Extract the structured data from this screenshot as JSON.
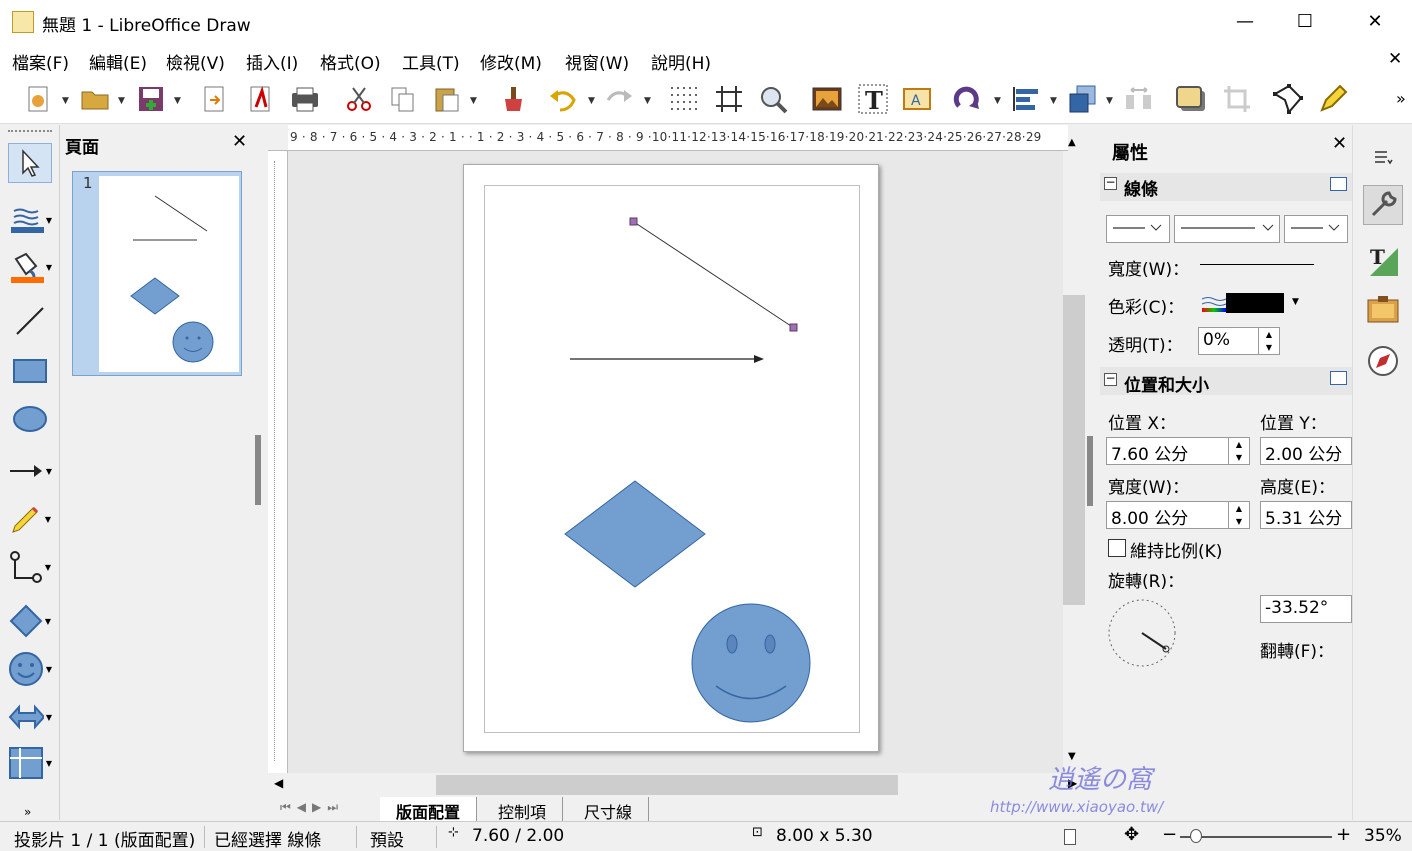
{
  "window": {
    "title": "無題 1 - LibreOffice Draw",
    "minimize": "—",
    "maximize": "☐",
    "close": "✕"
  },
  "menubar": {
    "items": [
      "檔案(F)",
      "編輯(E)",
      "檢視(V)",
      "插入(I)",
      "格式(O)",
      "工具(T)",
      "修改(M)",
      "視窗(W)",
      "說明(H)"
    ],
    "close_doc": "✕"
  },
  "pages_panel": {
    "title": "頁面",
    "close": "✕",
    "thumb_number": "1"
  },
  "ruler": {
    "h_ticks": "9 · 8 · 7 · 6 · 5 · 4 · 3 · 2 · 1 ·   · 1 · 2 · 3 · 4 · 5 · 6 · 7 · 8 · 9 ·10·11·12·13·14·15·16·17·18·19·20·21·22·23·24·25·26·27·28·29"
  },
  "tabs": [
    "版面配置",
    "控制項",
    "尺寸線"
  ],
  "properties": {
    "title": "屬性",
    "close": "✕",
    "line_section": {
      "title": "線條",
      "width_label": "寬度(W)：",
      "color_label": "色彩(C)：",
      "transparency_label": "透明(T)：",
      "transparency_value": "0%",
      "color_value": "#000000"
    },
    "pos_section": {
      "title": "位置和大小",
      "pos_x_label": "位置 X：",
      "pos_y_label": "位置 Y：",
      "pos_x_value": "7.60 公分",
      "pos_y_value": "2.00 公分",
      "width_label": "寬度(W)：",
      "height_label": "高度(E)：",
      "width_value": "8.00 公分",
      "height_value": "5.31 公分",
      "keep_ratio_label": "維持比例(K)",
      "rotation_label": "旋轉(R)：",
      "rotation_value": "-33.52°",
      "flip_label": "翻轉(F)："
    }
  },
  "statusbar": {
    "slide": "投影片 1 / 1 (版面配置)",
    "selection": "已經選擇 線條",
    "style": "預設",
    "position": "7.60 / 2.00",
    "size": "8.00 x 5.30",
    "zoom": "35%"
  },
  "watermark": "http://www.xiaoyao.tw/",
  "colors": {
    "accent": "#6f9fd6",
    "shape_fill": "#729fcf",
    "shape_stroke": "#3465a4"
  }
}
